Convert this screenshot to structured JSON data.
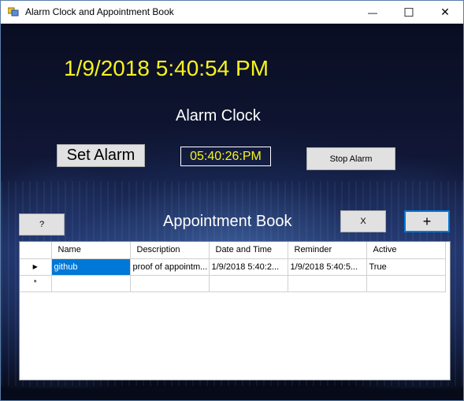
{
  "window": {
    "title": "Alarm Clock and Appointment Book",
    "controls": {
      "minimize": "—",
      "maximize": "☐",
      "close": "✕"
    }
  },
  "clock": {
    "current_datetime": "1/9/2018 5:40:54 PM",
    "heading": "Alarm Clock",
    "set_alarm_label": "Set Alarm",
    "alarm_time": "05:40:26:PM",
    "stop_alarm_label": "Stop Alarm"
  },
  "appointments": {
    "heading": "Appointment Book",
    "help_label": "?",
    "delete_label": "X",
    "add_label": "+",
    "columns": [
      "Name",
      "Description",
      "Date and Time",
      "Reminder",
      "Active"
    ],
    "rows": [
      [
        "github",
        "proof of appointm...",
        "1/9/2018 5:40:2...",
        "1/9/2018 5:40:5...",
        "True"
      ]
    ],
    "new_row_marker": "*",
    "current_row_marker": "▶"
  },
  "colors": {
    "clock_text": "#f7f31e",
    "selection": "#0078d7"
  }
}
